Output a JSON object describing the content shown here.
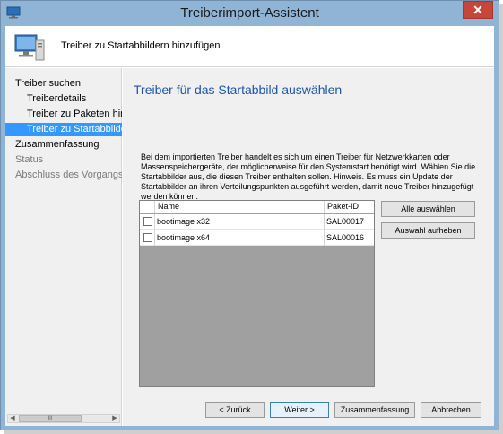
{
  "window": {
    "title": "Treiberimport-Assistent",
    "close_glyph": "✕"
  },
  "header": {
    "title": "Treiber zu Startabbildern hinzufügen",
    "icon": "computer-icon"
  },
  "sidebar": {
    "items": [
      {
        "label": "Treiber suchen",
        "level": "top",
        "state": "normal"
      },
      {
        "label": "Treiberdetails",
        "level": "sub",
        "state": "normal"
      },
      {
        "label": "Treiber zu Paketen hinzufügen",
        "level": "sub",
        "state": "normal"
      },
      {
        "label": "Treiber zu Startabbildern",
        "level": "sub",
        "state": "selected"
      },
      {
        "label": "Zusammenfassung",
        "level": "top",
        "state": "normal"
      },
      {
        "label": "Status",
        "level": "top",
        "state": "disabled"
      },
      {
        "label": "Abschluss des Vorgangs",
        "level": "top",
        "state": "disabled"
      }
    ],
    "scroll_thumb_glyph": "III"
  },
  "main": {
    "title": "Treiber für das Startabbild auswählen",
    "description": "Bei dem importierten Treiber handelt es sich um einen Treiber für Netzwerkkarten oder Massenspeichergeräte, der möglicherweise für den Systemstart benötigt wird. Wählen Sie die Startabbilder aus, die diesen Treiber enthalten sollen. Hinweis. Es muss ein Update der Startabbilder an ihren Verteilungspunkten ausgeführt werden, damit neue Treiber hinzugefügt werden können.",
    "list": {
      "columns": [
        "Name",
        "Paket-ID"
      ],
      "rows": [
        {
          "checked": false,
          "name": "bootimage x32",
          "package_id": "SAL00017"
        },
        {
          "checked": false,
          "name": "bootimage x64",
          "package_id": "SAL00016"
        }
      ]
    },
    "select_all_label": "Alle auswählen",
    "deselect_label": "Auswahl aufheben"
  },
  "footer": {
    "back_label": "< Zurück",
    "next_label": "Weiter >",
    "summary_label": "Zusammenfassung",
    "cancel_label": "Abbrechen"
  },
  "colors": {
    "titlebar": "#8fb4d6",
    "selection": "#3399ff",
    "heading": "#1b54b3",
    "close": "#c7463c"
  }
}
